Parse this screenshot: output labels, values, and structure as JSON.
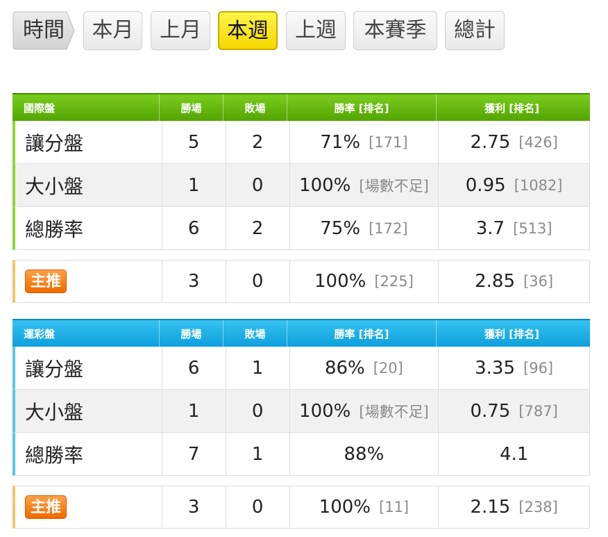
{
  "tabs": {
    "label": "時間",
    "items": [
      {
        "label": "本月",
        "active": false
      },
      {
        "label": "上月",
        "active": false
      },
      {
        "label": "本週",
        "active": true
      },
      {
        "label": "上週",
        "active": false
      },
      {
        "label": "本賽季",
        "active": false
      },
      {
        "label": "總計",
        "active": false
      }
    ]
  },
  "tables": [
    {
      "header": {
        "title": "國際盤",
        "wins": "勝場",
        "losses": "敗場",
        "rate": "勝率 [排名]",
        "profit": "獲利 [排名]"
      },
      "rows": [
        {
          "name": "讓分盤",
          "wins": "5",
          "losses": "2",
          "rate": "71%",
          "rate_rank": "[171]",
          "profit": "2.75",
          "profit_rank": "[426]"
        },
        {
          "name": "大小盤",
          "wins": "1",
          "losses": "0",
          "rate": "100%",
          "rate_rank": "[場數不足]",
          "profit": "0.95",
          "profit_rank": "[1082]"
        },
        {
          "name": "總勝率",
          "wins": "6",
          "losses": "2",
          "rate": "75%",
          "rate_rank": "[172]",
          "profit": "3.7",
          "profit_rank": "[513]"
        }
      ],
      "pick": {
        "badge": "主推",
        "wins": "3",
        "losses": "0",
        "rate": "100%",
        "rate_rank": "[225]",
        "profit": "2.85",
        "profit_rank": "[36]"
      }
    },
    {
      "header": {
        "title": "運彩盤",
        "wins": "勝場",
        "losses": "敗場",
        "rate": "勝率 [排名]",
        "profit": "獲利 [排名]"
      },
      "rows": [
        {
          "name": "讓分盤",
          "wins": "6",
          "losses": "1",
          "rate": "86%",
          "rate_rank": "[20]",
          "profit": "3.35",
          "profit_rank": "[96]"
        },
        {
          "name": "大小盤",
          "wins": "1",
          "losses": "0",
          "rate": "100%",
          "rate_rank": "[場數不足]",
          "profit": "0.75",
          "profit_rank": "[787]"
        },
        {
          "name": "總勝率",
          "wins": "7",
          "losses": "1",
          "rate": "88%",
          "rate_rank": "",
          "profit": "4.1",
          "profit_rank": ""
        }
      ],
      "pick": {
        "badge": "主推",
        "wins": "3",
        "losses": "0",
        "rate": "100%",
        "rate_rank": "[11]",
        "profit": "2.15",
        "profit_rank": "[238]"
      }
    }
  ]
}
